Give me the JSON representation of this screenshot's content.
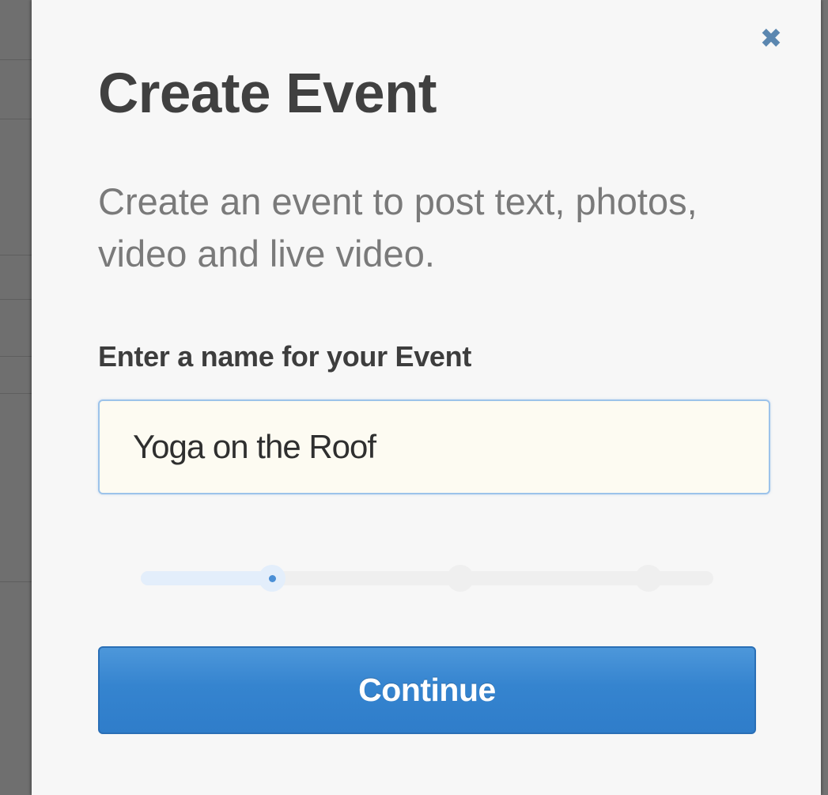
{
  "modal": {
    "close_icon": "close-icon",
    "close_glyph": "✖",
    "title": "Create Event",
    "description": "Create an event to post text, photos, video and live video.",
    "field_label": "Enter a name for your Event",
    "event_name_value": "Yoga on the Roof",
    "progress": {
      "total_steps": 3,
      "current_step": 1
    },
    "continue_label": "Continue"
  },
  "colors": {
    "accent": "#2f7dca",
    "close": "#5b87b0",
    "title": "#404040",
    "description": "#7a7a7a",
    "input_background": "#fdfbf2",
    "input_border": "#9cc3ea",
    "modal_background": "#f7f7f7"
  }
}
